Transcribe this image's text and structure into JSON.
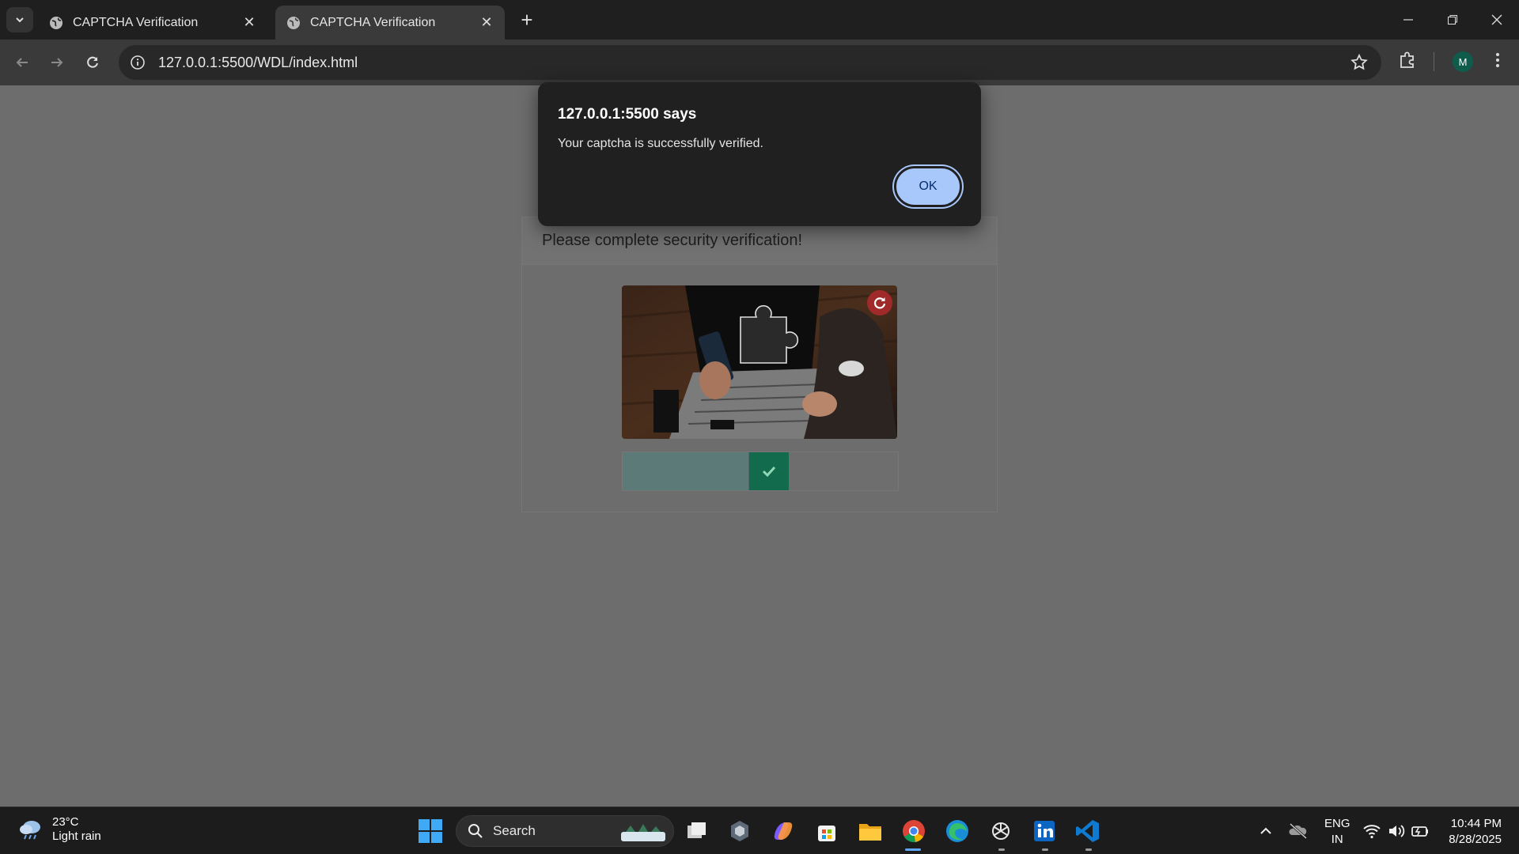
{
  "browser": {
    "tabs": [
      {
        "title": "CAPTCHA Verification"
      },
      {
        "title": "CAPTCHA Verification"
      }
    ],
    "url": "127.0.0.1:5500/WDL/index.html",
    "profile_initial": "M"
  },
  "page": {
    "card_header": "Please complete security verification!",
    "slider_state": "verified",
    "slider_progress_percent": 46
  },
  "dialog": {
    "title": "127.0.0.1:5500 says",
    "message": "Your captcha is successfully verified.",
    "ok_label": "OK"
  },
  "taskbar": {
    "weather": {
      "temp": "23°C",
      "condition": "Light rain"
    },
    "search_label": "Search",
    "language": {
      "line1": "ENG",
      "line2": "IN"
    },
    "time": "10:44 PM",
    "date": "8/28/2025"
  },
  "colors": {
    "accent": "#a8c7fa",
    "slider_handle": "#126b4c",
    "refresh": "#a02a2a"
  }
}
